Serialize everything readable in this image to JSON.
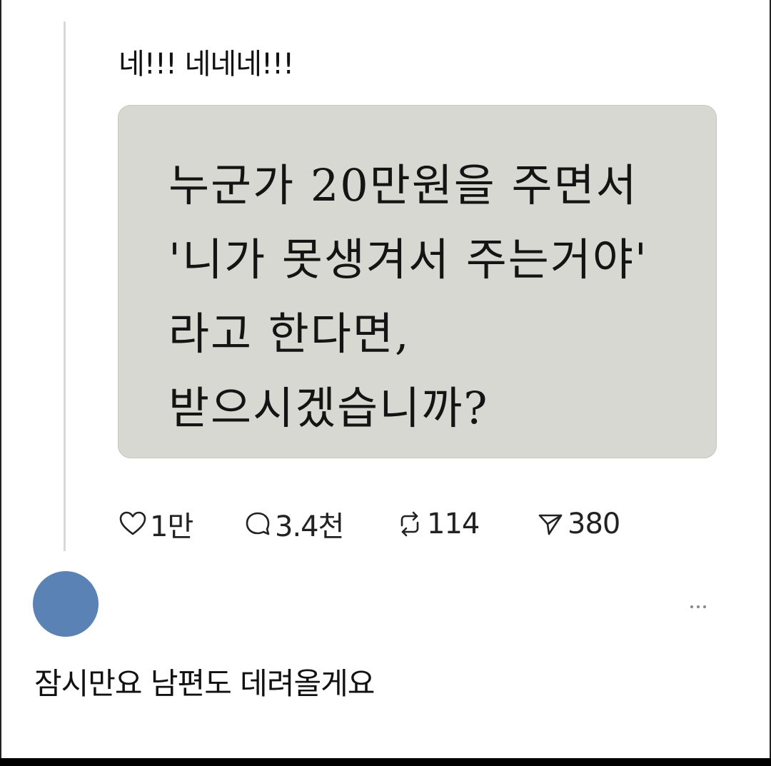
{
  "post": {
    "text": "네!!! 네네네!!!",
    "image_text": {
      "lines": [
        "누군가  20만원을 주면서",
        "'니가 못생겨서 주는거야'",
        "라고  한다면,",
        "받으시겠습니까?"
      ]
    },
    "actions": {
      "likes": "1만",
      "replies": "3.4천",
      "reposts": "114",
      "shares": "380"
    }
  },
  "reply": {
    "text": "잠시만요 남편도 데려올게요",
    "avatar_color": "#5a82b4"
  },
  "icons": {
    "like": "heart-icon",
    "reply": "speech-bubble-icon",
    "repost": "repost-arrows-icon",
    "share": "paper-plane-icon",
    "more": "more-options-icon"
  }
}
